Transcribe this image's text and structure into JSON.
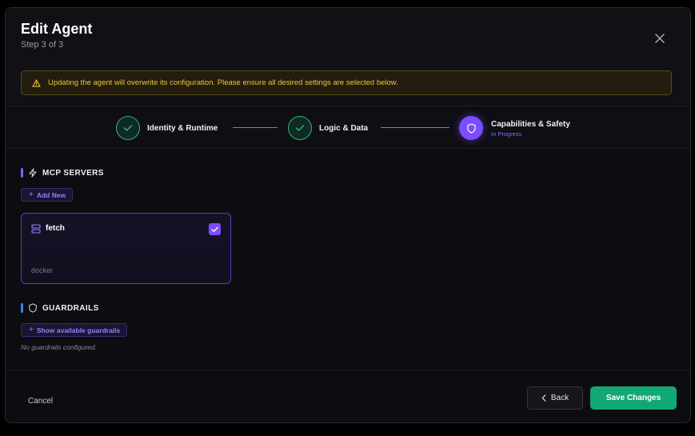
{
  "dialog": {
    "title": "Edit Agent",
    "subtitle": "Step 3 of 3",
    "close_icon": "close-icon"
  },
  "warning": {
    "icon": "warning-triangle-icon",
    "text": "Updating the agent will overwrite its configuration. Please ensure all desired settings are selected below.",
    "color": "#f0c43a"
  },
  "steps": [
    {
      "label": "Identity & Runtime",
      "status": "complete"
    },
    {
      "label": "Logic & Data",
      "status": "complete"
    },
    {
      "label": "Capabilities & Safety",
      "status": "active",
      "sublabel": "In Progress"
    }
  ],
  "mcp": {
    "title": "MCP SERVERS",
    "icon": "plug-icon",
    "add_label": "Add New",
    "servers": [
      {
        "name": "fetch",
        "type": "docker",
        "selected": true,
        "icon": "server-icon"
      }
    ]
  },
  "guardrails": {
    "title": "GUARDRAILS",
    "icon": "shield-icon",
    "show_label": "Show available guardrails",
    "empty_text": "No guardrails configured."
  },
  "footer": {
    "cancel_label": "Cancel",
    "back_label": "Back",
    "save_label": "Save Changes"
  },
  "colors": {
    "accent": "#7c4dff",
    "success": "#2bb287",
    "save": "#12a876",
    "warning_text": "#f0c43a"
  }
}
